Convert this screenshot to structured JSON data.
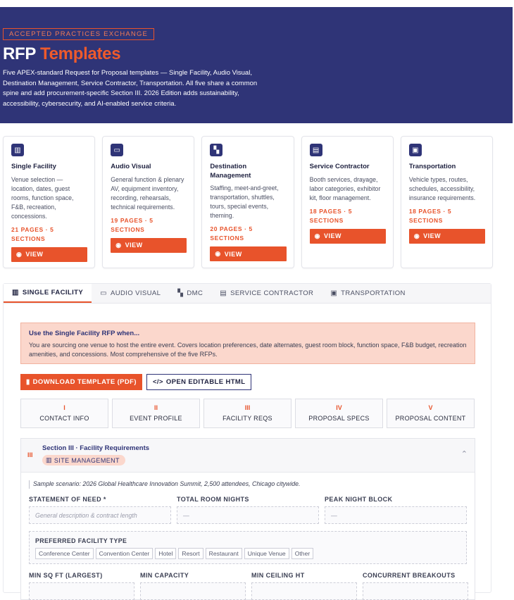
{
  "hero": {
    "eyebrow": "ACCEPTED PRACTICES EXCHANGE",
    "title_main": "RFP",
    "title_accent": "Templates",
    "description": "Five APEX-standard Request for Proposal templates — Single Facility, Audio Visual, Destination Management, Service Contractor, Transportation. All five share a common spine and add procurement-specific Section III. 2026 Edition adds sustainability, accessibility, cybersecurity, and AI-enabled service criteria."
  },
  "cards": [
    {
      "icon": "building-icon",
      "title": "Single Facility",
      "desc": "Venue selection — location, dates, guest rooms, function space, F&B, recreation, concessions.",
      "meta": "21 PAGES · 5 SECTIONS",
      "view": "VIEW"
    },
    {
      "icon": "monitor-icon",
      "title": "Audio Visual",
      "desc": "General function & plenary AV, equipment inventory, recording, rehearsals, technical requirements.",
      "meta": "19 PAGES · 5 SECTIONS",
      "view": "VIEW"
    },
    {
      "icon": "people-icon",
      "title": "Destination Management",
      "desc": "Staffing, meet-and-greet, transportation, shuttles, tours, special events, theming.",
      "meta": "20 PAGES · 5 SECTIONS",
      "view": "VIEW"
    },
    {
      "icon": "booth-icon",
      "title": "Service Contractor",
      "desc": "Booth services, drayage, labor categories, exhibitor kit, floor management.",
      "meta": "18 PAGES · 5 SECTIONS",
      "view": "VIEW"
    },
    {
      "icon": "bus-icon",
      "title": "Transportation",
      "desc": "Vehicle types, routes, schedules, accessibility, insurance requirements.",
      "meta": "18 PAGES · 5 SECTIONS",
      "view": "VIEW"
    }
  ],
  "tabs": [
    {
      "icon": "building-icon",
      "label": "SINGLE FACILITY"
    },
    {
      "icon": "monitor-icon",
      "label": "AUDIO VISUAL"
    },
    {
      "icon": "people-icon",
      "label": "DMC"
    },
    {
      "icon": "booth-icon",
      "label": "SERVICE CONTRACTOR"
    },
    {
      "icon": "bus-icon",
      "label": "TRANSPORTATION"
    }
  ],
  "use_when": {
    "title": "Use the Single Facility RFP when...",
    "text": "You are sourcing one venue to host the entire event. Covers location preferences, date alternates, guest room block, function space, F&B budget, recreation amenities, and concessions. Most comprehensive of the five RFPs."
  },
  "actions": {
    "download": "DOWNLOAD TEMPLATE (PDF)",
    "open_html": "OPEN EDITABLE HTML"
  },
  "sections": [
    {
      "num": "I",
      "label": "CONTACT INFO"
    },
    {
      "num": "II",
      "label": "EVENT PROFILE"
    },
    {
      "num": "III",
      "label": "FACILITY REQS"
    },
    {
      "num": "IV",
      "label": "PROPOSAL SPECS"
    },
    {
      "num": "V",
      "label": "PROPOSAL CONTENT"
    }
  ],
  "accordion": {
    "num": "III",
    "title": "Section III · Facility Requirements",
    "badge": "SITE MANAGEMENT",
    "scenario": "Sample scenario: 2026 Global Healthcare Innovation Summit, 2,500 attendees, Chicago citywide.",
    "fields_row1": [
      {
        "label": "STATEMENT OF NEED *",
        "value": "General description & contract length"
      },
      {
        "label": "TOTAL ROOM NIGHTS",
        "value": "—"
      },
      {
        "label": "PEAK NIGHT BLOCK",
        "value": "—"
      }
    ],
    "facility_type": {
      "label": "PREFERRED FACILITY TYPE",
      "options": [
        "Conference Center",
        "Convention Center",
        "Hotel",
        "Resort",
        "Restaurant",
        "Unique Venue",
        "Other"
      ]
    },
    "fields_row2": [
      {
        "label": "MIN SQ FT (LARGEST)"
      },
      {
        "label": "MIN CAPACITY"
      },
      {
        "label": "MIN CEILING HT"
      },
      {
        "label": "CONCURRENT BREAKOUTS"
      }
    ]
  },
  "colors": {
    "navy": "#2f3477",
    "orange": "#e8532b",
    "pink": "#fbd7cc"
  }
}
